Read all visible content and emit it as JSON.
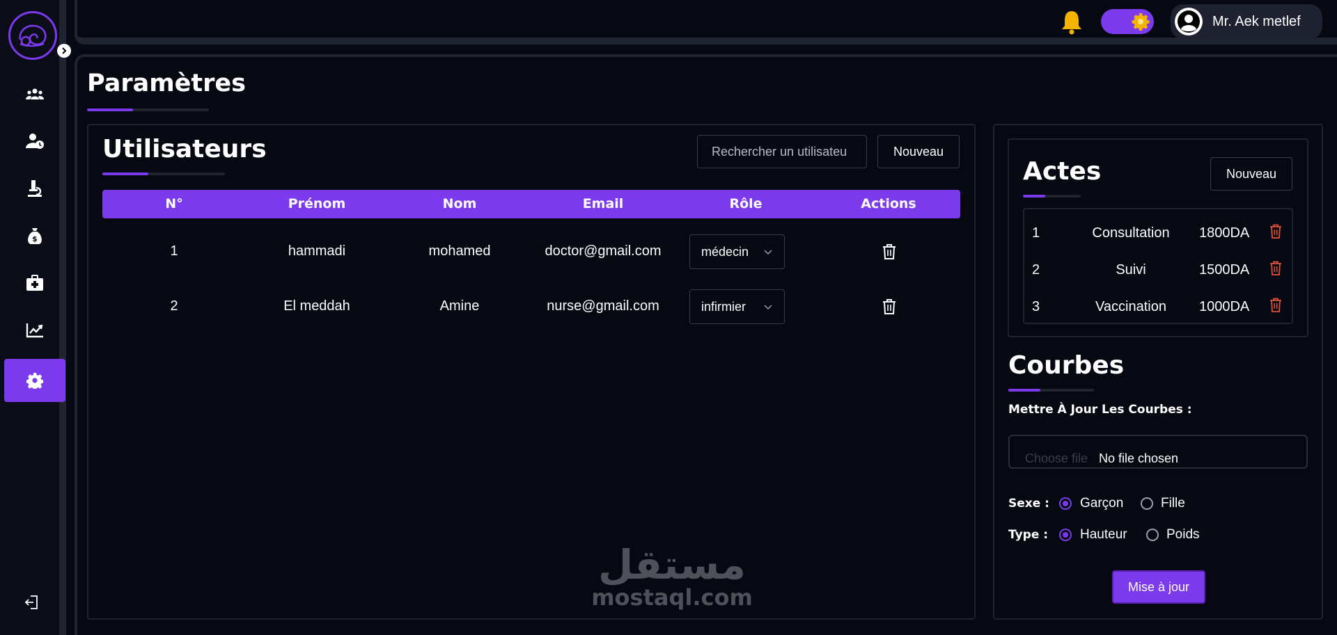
{
  "topbar": {
    "user_name": "Mr. Aek metlef",
    "icons": [
      "bell-icon",
      "theme-toggle",
      "user-avatar-icon"
    ]
  },
  "sidebar": {
    "items": [
      {
        "icon": "users-group-icon"
      },
      {
        "icon": "user-clock-icon"
      },
      {
        "icon": "microscope-icon"
      },
      {
        "icon": "money-bag-icon"
      },
      {
        "icon": "medical-kit-icon"
      },
      {
        "icon": "chart-line-icon"
      },
      {
        "icon": "gear-icon",
        "active": true
      }
    ],
    "logout_icon": "logout-icon"
  },
  "page": {
    "title": "Paramètres"
  },
  "users": {
    "title": "Utilisateurs",
    "search_placeholder": "Rechercher un utilisateu",
    "new_label": "Nouveau",
    "columns": [
      "N°",
      "Prénom",
      "Nom",
      "Email",
      "Rôle",
      "Actions"
    ],
    "rows": [
      {
        "n": "1",
        "prenom": "hammadi",
        "nom": "mohamed",
        "email": "doctor@gmail.com",
        "role": "médecin"
      },
      {
        "n": "2",
        "prenom": "El meddah",
        "nom": "Amine",
        "email": "nurse@gmail.com",
        "role": "infirmier"
      }
    ]
  },
  "actes": {
    "title": "Actes",
    "new_label": "Nouveau",
    "rows": [
      {
        "n": "1",
        "name": "Consultation",
        "price": "1800DA"
      },
      {
        "n": "2",
        "name": "Suivi",
        "price": "1500DA"
      },
      {
        "n": "3",
        "name": "Vaccination",
        "price": "1000DA"
      }
    ]
  },
  "courbes": {
    "title": "Courbes",
    "update_label": "Mettre À Jour Les Courbes :",
    "file_button": "Choose file",
    "file_status": "No file chosen",
    "sexe_label": "Sexe :",
    "sexe_options": [
      "Garçon",
      "Fille"
    ],
    "sexe_selected": "Garçon",
    "type_label": "Type :",
    "type_options": [
      "Hauteur",
      "Poids"
    ],
    "type_selected": "Hauteur",
    "submit_label": "Mise à jour"
  },
  "watermark": {
    "arabic": "مستقل",
    "latin": "mostaql.com"
  },
  "colors": {
    "accent": "#7c3aed",
    "background": "#060912",
    "bell": "#f5b301",
    "delete": "#e0533b"
  }
}
